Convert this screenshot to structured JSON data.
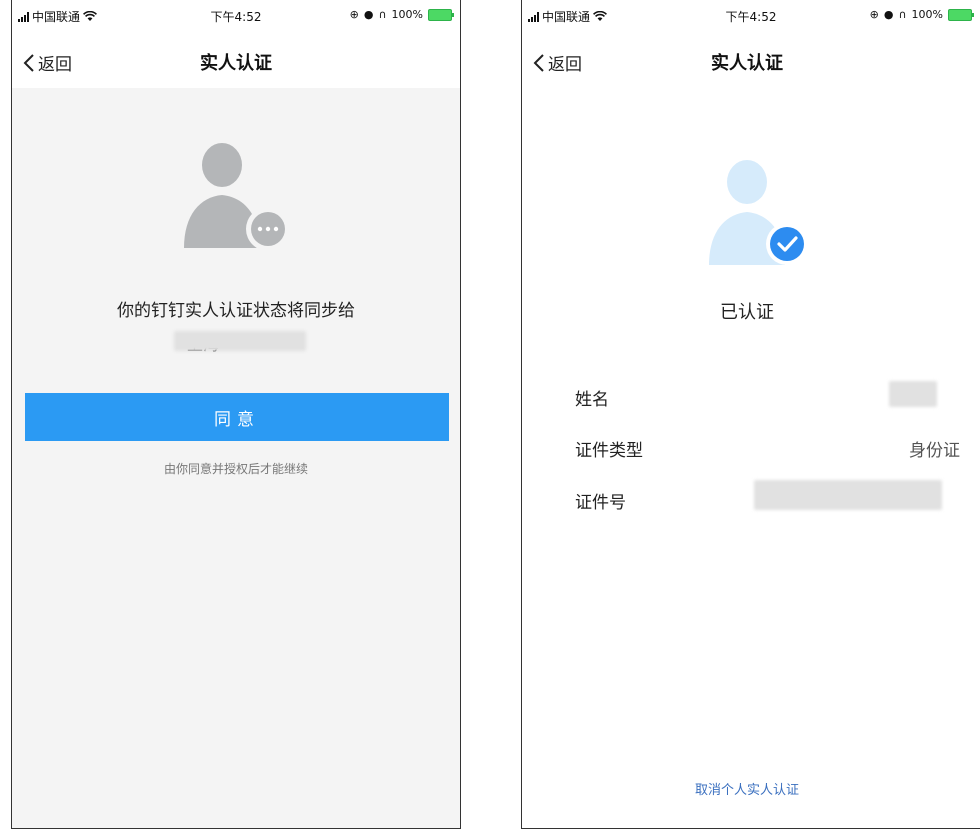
{
  "status_bar": {
    "carrier": "中国联通",
    "time": "下午4:52",
    "battery": "100%"
  },
  "icons": {
    "back": "chevron-left-icon",
    "wifi": "wifi-icon",
    "pending": "more-dots-icon",
    "verified": "checkmark-icon"
  },
  "colors": {
    "primary": "#2b9af3",
    "avatar_gray": "#b4b6b8",
    "avatar_light": "#d6ebfb",
    "check_blue": "#2d8cf0",
    "page_bg": "#f4f4f4"
  },
  "left_screen": {
    "nav": {
      "back_label": "返回",
      "title": "实人认证"
    },
    "sync_message": "你的钉钉实人认证状态将同步给",
    "org_prefix": "「上海",
    "agree_button": "同意",
    "hint": "由你同意并授权后才能继续"
  },
  "right_screen": {
    "nav": {
      "back_label": "返回",
      "title": "实人认证"
    },
    "status": "已认证",
    "rows": [
      {
        "label": "姓名",
        "value": ""
      },
      {
        "label": "证件类型",
        "value": "身份证"
      },
      {
        "label": "证件号",
        "value": ""
      }
    ],
    "cancel_link": "取消个人实人认证"
  }
}
